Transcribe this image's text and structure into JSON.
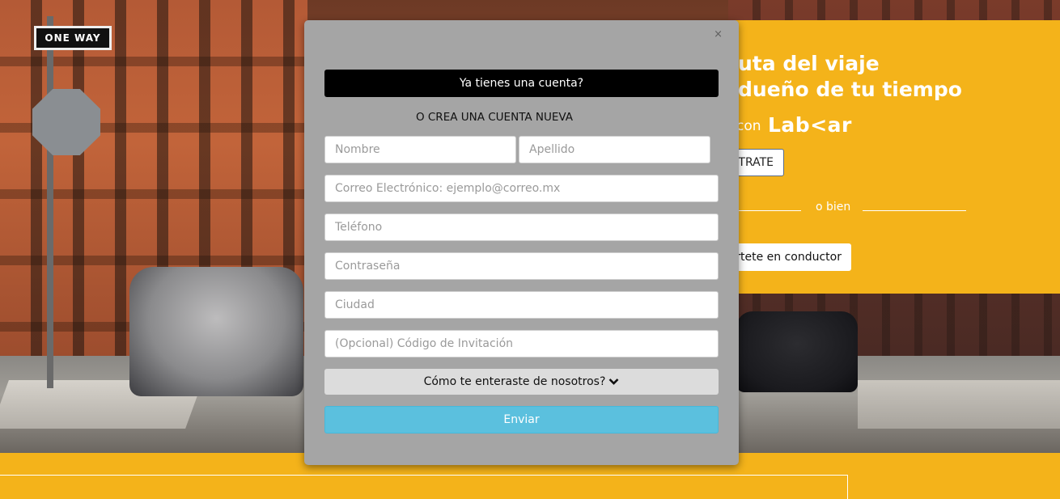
{
  "background": {
    "street_sign": "ONE WAY"
  },
  "promo": {
    "headline_line1": "uta del viaje",
    "headline_line2": "dueño de tu tiempo",
    "con_text": "con",
    "brand": "Lab<ar",
    "register_label": "TRATE",
    "divider_text": "o bien",
    "driver_button_label": "ertete en conductor"
  },
  "modal": {
    "close_label": "×",
    "account_button_label": "Ya tienes una cuenta?",
    "create_account_label": "O CREA UNA CUENTA NUEVA",
    "fields": {
      "first_name_placeholder": "Nombre",
      "last_name_placeholder": "Apellido",
      "email_placeholder": "Correo Electrónico: ejemplo@correo.mx",
      "phone_placeholder": "Teléfono",
      "password_placeholder": "Contraseña",
      "city_placeholder": "Ciudad",
      "invite_code_placeholder": "(Opcional) Código de Invitación"
    },
    "how_found_label": "Cómo te enteraste de nosotros?",
    "submit_label": "Enviar"
  },
  "colors": {
    "brand_yellow": "#f4b31a",
    "modal_bg": "#a5a5a5",
    "submit_blue": "#5bc0de",
    "account_black": "#000000"
  }
}
